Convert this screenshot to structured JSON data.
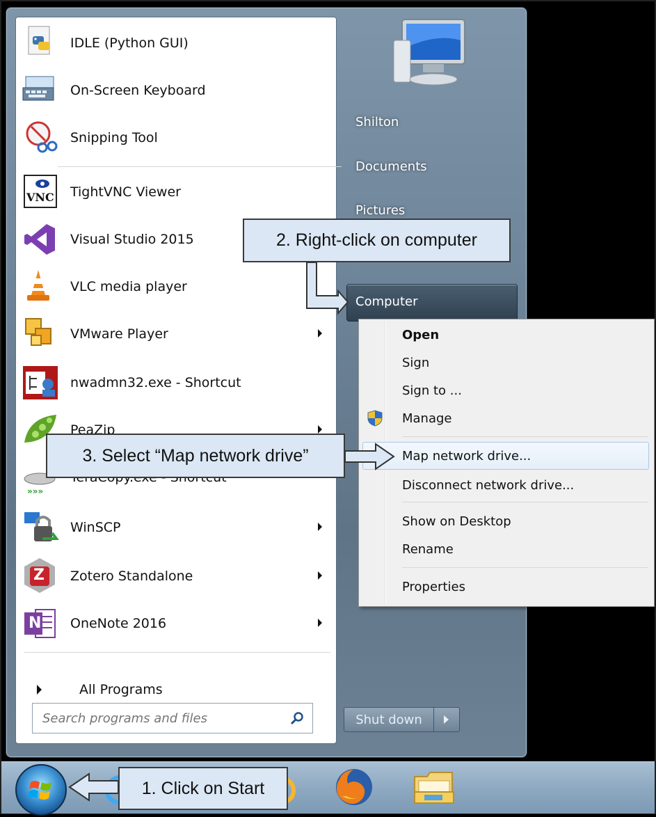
{
  "programs": [
    {
      "label": "IDLE (Python GUI)",
      "icon": "python-idle-icon",
      "submenu": false
    },
    {
      "label": "On-Screen Keyboard",
      "icon": "keyboard-icon",
      "submenu": false
    },
    {
      "label": "Snipping Tool",
      "icon": "snipping-tool-icon",
      "submenu": false
    },
    {
      "label": "TightVNC Viewer",
      "icon": "vnc-icon",
      "submenu": false,
      "icon_text": "VNC"
    },
    {
      "label": "Visual Studio 2015",
      "icon": "visual-studio-icon",
      "submenu": false
    },
    {
      "label": "VLC media player",
      "icon": "vlc-cone-icon",
      "submenu": false
    },
    {
      "label": "VMware Player",
      "icon": "vmware-icon",
      "submenu": true
    },
    {
      "label": "nwadmn32.exe - Shortcut",
      "icon": "nwadmin-icon",
      "submenu": false
    },
    {
      "label": "PeaZip",
      "icon": "peazip-icon",
      "submenu": true
    },
    {
      "label": "TeraCopy.exe - Shortcut",
      "icon": "teracopy-icon",
      "submenu": false
    },
    {
      "label": "WinSCP",
      "icon": "winscp-icon",
      "submenu": true
    },
    {
      "label": "Zotero Standalone",
      "icon": "zotero-icon",
      "submenu": true,
      "icon_text": "Z"
    },
    {
      "label": "OneNote 2016",
      "icon": "onenote-icon",
      "submenu": true,
      "icon_text": "N"
    }
  ],
  "all_programs": "All Programs",
  "search": {
    "placeholder": "Search programs and files"
  },
  "right_links": {
    "user": "Shilton",
    "documents": "Documents",
    "pictures": "Pictures",
    "computer": "Computer"
  },
  "shutdown": {
    "label": "Shut down"
  },
  "context_menu": {
    "open": "Open",
    "sign": "Sign",
    "sign_to": "Sign to ...",
    "manage": "Manage",
    "map_drive": "Map network drive...",
    "disconnect": "Disconnect network drive...",
    "show_desktop": "Show on Desktop",
    "rename": "Rename",
    "properties": "Properties"
  },
  "callouts": {
    "step1": "1. Click on Start",
    "step2": "2. Right-click on computer",
    "step3": "3. Select “Map network drive”"
  },
  "colors": {
    "callout_fill": "#dbe7f4",
    "menu_glass": "#6f8599",
    "taskbar": "#8ea9c1"
  }
}
